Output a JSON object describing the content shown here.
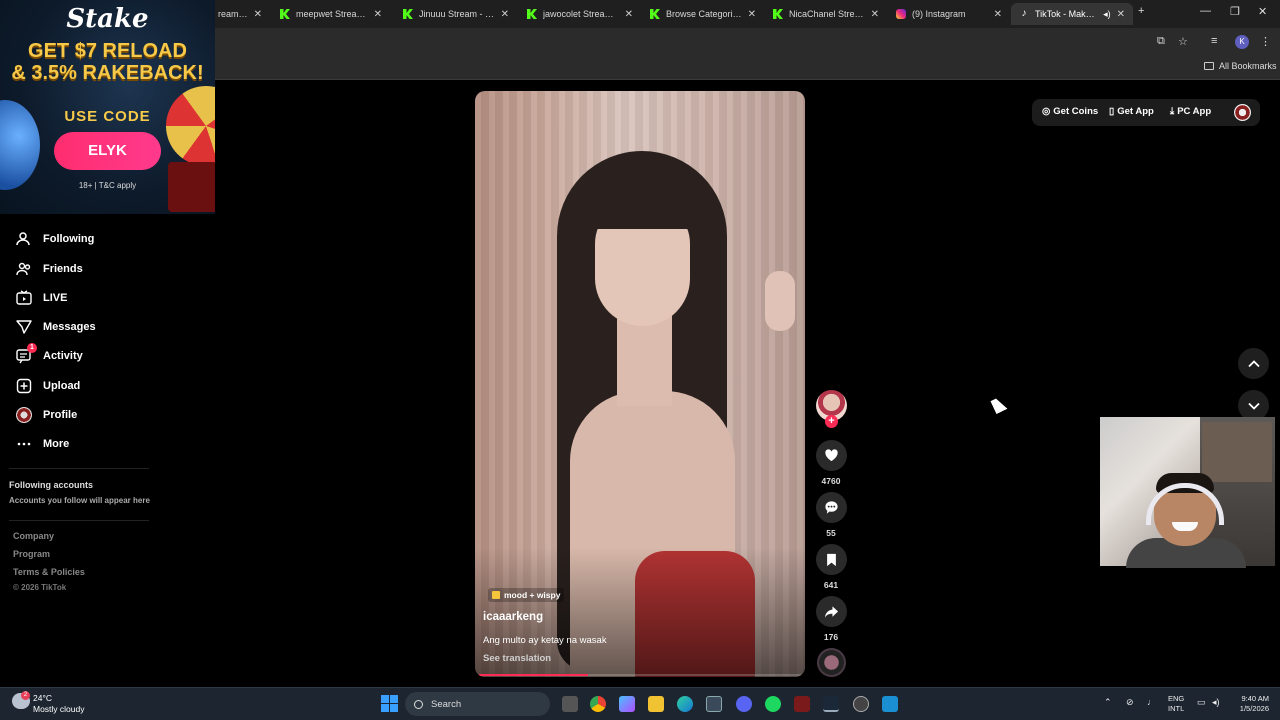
{
  "browser": {
    "tabs": [
      {
        "label": "ream - W",
        "icon": "kick-icon"
      },
      {
        "label": "meepwet Stream - W",
        "icon": "kick-icon"
      },
      {
        "label": "Jinuuu Stream - Watc",
        "icon": "kick-icon"
      },
      {
        "label": "jawocolet Stream - W",
        "icon": "kick-icon"
      },
      {
        "label": "Browse Categories - ",
        "icon": "kick-icon"
      },
      {
        "label": "NicaChanel Stream - ",
        "icon": "kick-icon"
      },
      {
        "label": "(9) Instagram",
        "icon": "instagram-icon"
      },
      {
        "label": "TikTok - Make Yo",
        "icon": "tiktok-icon"
      }
    ],
    "new_tab": "+",
    "profile_initial": "K",
    "all_bookmarks": "All Bookmarks",
    "close_glyph": "✕"
  },
  "ad": {
    "brand": "Stake",
    "headline_1": "GET $7 RELOAD",
    "headline_2": "& 3.5% RAKEBACK!",
    "code_label": "USE CODE",
    "code": "ELYK",
    "fineprint": "18+ | T&C apply"
  },
  "sidebar": {
    "items": [
      {
        "label": "Following",
        "icon": "following-icon"
      },
      {
        "label": "Friends",
        "icon": "friends-icon"
      },
      {
        "label": "LIVE",
        "icon": "live-icon"
      },
      {
        "label": "Messages",
        "icon": "messages-icon"
      },
      {
        "label": "Activity",
        "icon": "activity-icon",
        "badge": "1"
      },
      {
        "label": "Upload",
        "icon": "upload-icon"
      },
      {
        "label": "Profile",
        "icon": "profile-avatar"
      },
      {
        "label": "More",
        "icon": "more-icon"
      }
    ],
    "following_title": "Following accounts",
    "following_sub": "Accounts you follow will appear here",
    "footer": [
      "Company",
      "Program",
      "Terms & Policies"
    ],
    "copyright": "© 2026 TikTok"
  },
  "header": {
    "get_coins": "Get Coins",
    "get_app": "Get App",
    "pc_app": "PC App"
  },
  "video": {
    "tag": "mood + wispy",
    "username": "icaaarkeng",
    "caption": "Ang multo ay ketay na wasak",
    "see_translation": "See translation",
    "progress": 0.34
  },
  "actions": {
    "likes": "4760",
    "comments": "55",
    "saves": "641",
    "shares": "176"
  },
  "taskbar": {
    "temp": "24°C",
    "weather": "Mostly cloudy",
    "weather_badge": "2",
    "search": "Search",
    "lang_1": "ENG",
    "lang_2": "INTL",
    "time": "9:40 AM",
    "date": "1/5/2026"
  },
  "colors": {
    "accent": "#fe2c55",
    "background": "#000000",
    "ad_gold": "#f7c948"
  }
}
